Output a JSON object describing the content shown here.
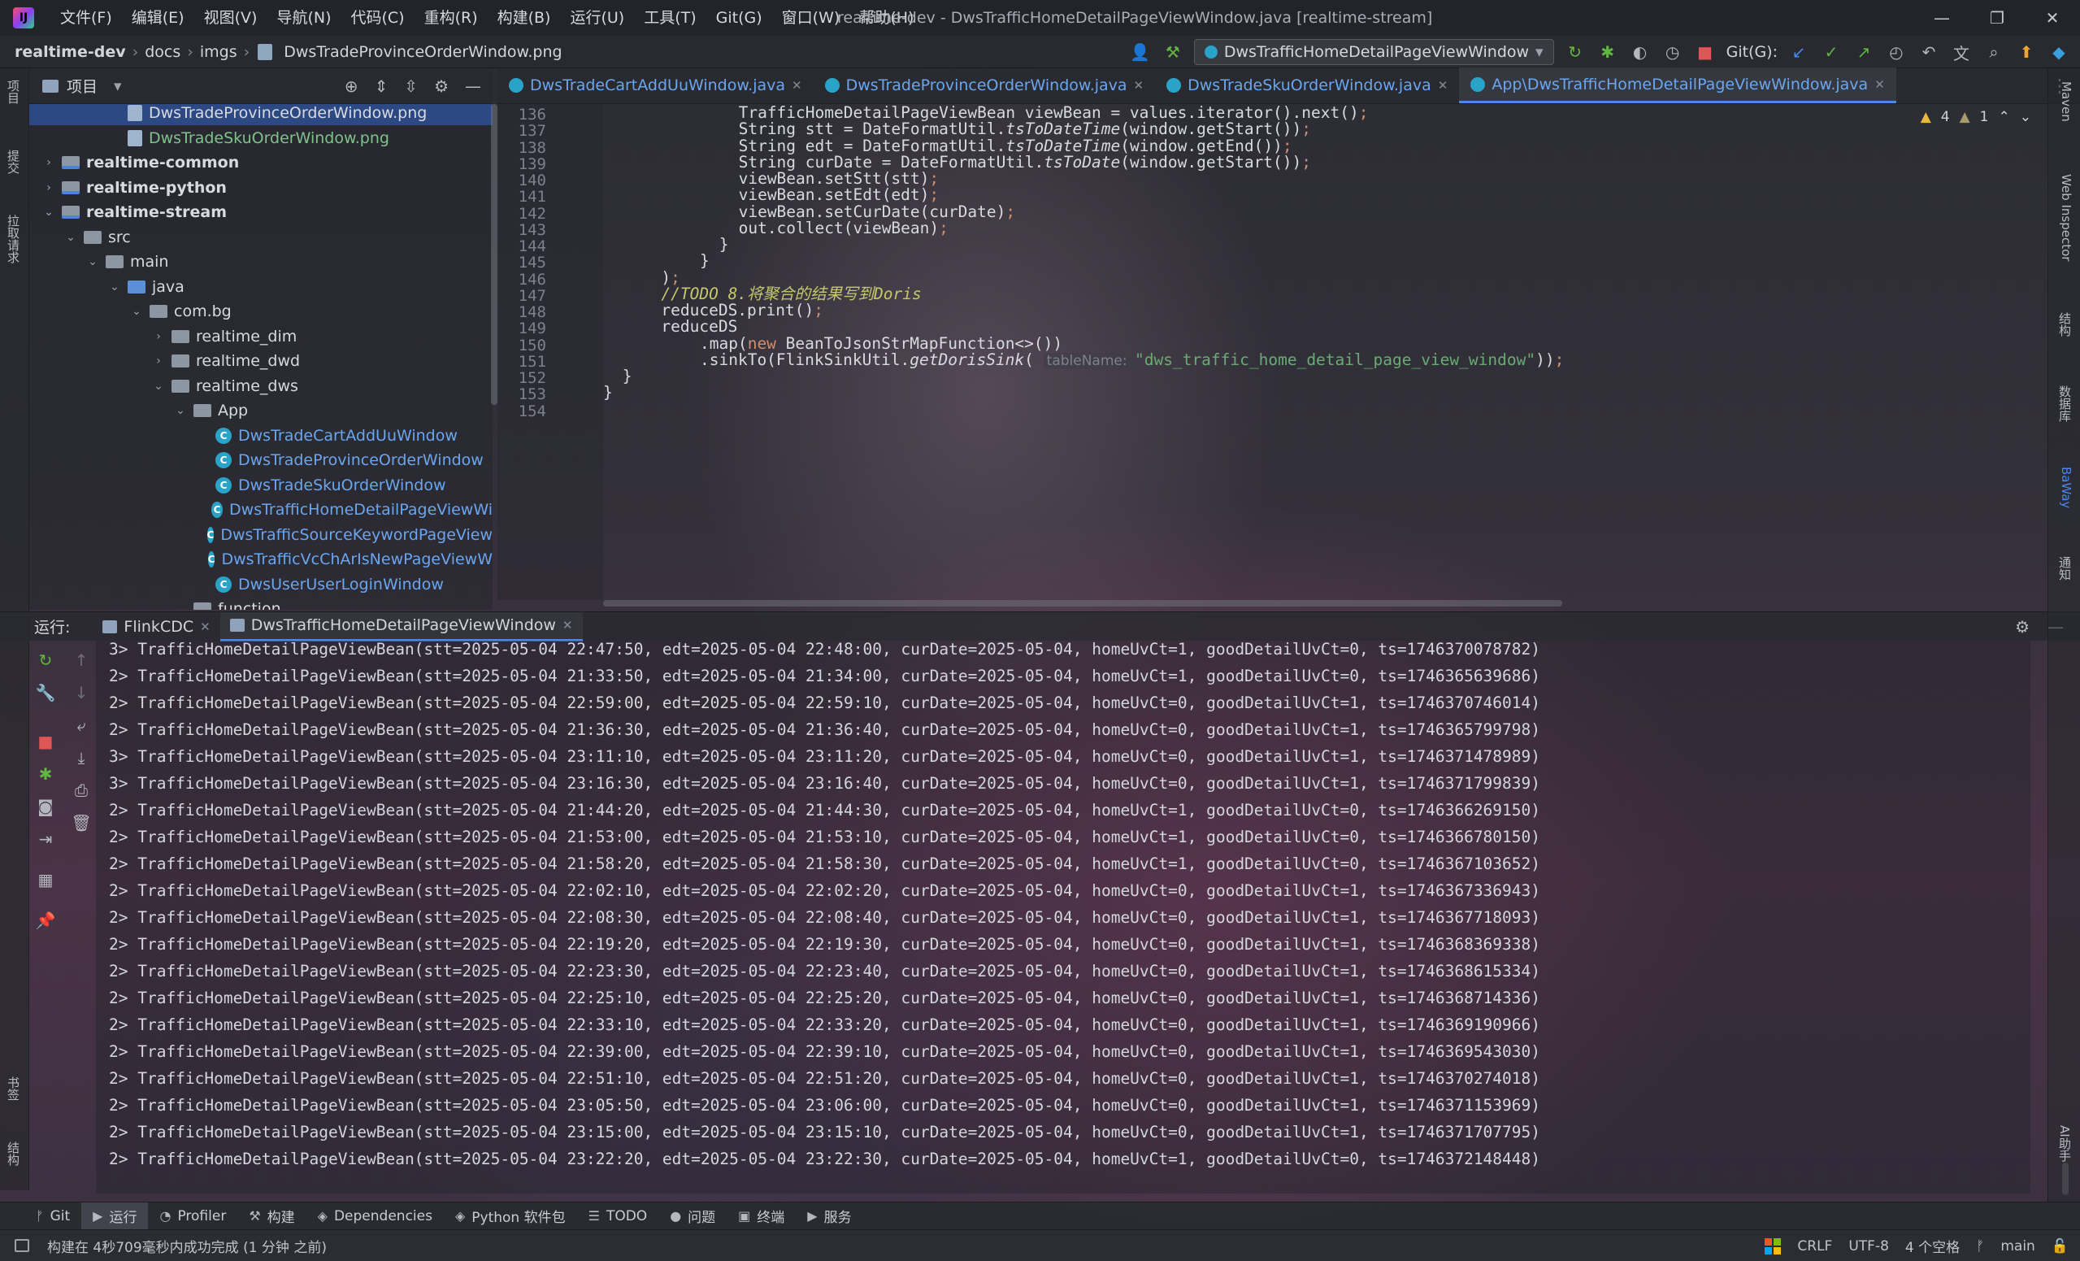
{
  "menu": [
    "文件(F)",
    "编辑(E)",
    "视图(V)",
    "导航(N)",
    "代码(C)",
    "重构(R)",
    "构建(B)",
    "运行(U)",
    "工具(T)",
    "Git(G)",
    "窗口(W)",
    "帮助(H)"
  ],
  "window_title": "realtime-dev - DwsTrafficHomeDetailPageViewWindow.java [realtime-stream]",
  "breadcrumb": [
    "realtime-dev",
    "docs",
    "imgs",
    "DwsTradeProvinceOrderWindow.png"
  ],
  "run_config": "DwsTrafficHomeDetailPageViewWindow",
  "git_label": "Git(G):",
  "left_strip": {
    "project": "项目",
    "commit": "提交",
    "pull_requests": "拉取请求",
    "bookmarks": "书签",
    "structure": "结构"
  },
  "project_panel": {
    "title": "项目"
  },
  "tree": [
    {
      "label": "DwsTradeProvinceOrderWindow.png",
      "depth": 4,
      "icon": "png",
      "style": "normal",
      "selected": true,
      "arrow": ""
    },
    {
      "label": "DwsTradeSkuOrderWindow.png",
      "depth": 4,
      "icon": "png",
      "style": "green",
      "selected": false,
      "arrow": ""
    },
    {
      "label": "realtime-common",
      "depth": 1,
      "icon": "module",
      "style": "bold",
      "selected": false,
      "arrow": "›"
    },
    {
      "label": "realtime-python",
      "depth": 1,
      "icon": "module",
      "style": "bold",
      "selected": false,
      "arrow": "›"
    },
    {
      "label": "realtime-stream",
      "depth": 1,
      "icon": "module",
      "style": "bold",
      "selected": false,
      "arrow": "⌄"
    },
    {
      "label": "src",
      "depth": 2,
      "icon": "folder",
      "style": "normal",
      "selected": false,
      "arrow": "⌄"
    },
    {
      "label": "main",
      "depth": 3,
      "icon": "folder",
      "style": "normal",
      "selected": false,
      "arrow": "⌄"
    },
    {
      "label": "java",
      "depth": 4,
      "icon": "folder-blue",
      "style": "normal",
      "selected": false,
      "arrow": "⌄"
    },
    {
      "label": "com.bg",
      "depth": 5,
      "icon": "folder",
      "style": "normal",
      "selected": false,
      "arrow": "⌄"
    },
    {
      "label": "realtime_dim",
      "depth": 6,
      "icon": "folder",
      "style": "normal",
      "selected": false,
      "arrow": "›"
    },
    {
      "label": "realtime_dwd",
      "depth": 6,
      "icon": "folder",
      "style": "normal",
      "selected": false,
      "arrow": "›"
    },
    {
      "label": "realtime_dws",
      "depth": 6,
      "icon": "folder",
      "style": "normal",
      "selected": false,
      "arrow": "⌄"
    },
    {
      "label": "App",
      "depth": 7,
      "icon": "folder",
      "style": "normal",
      "selected": false,
      "arrow": "⌄"
    },
    {
      "label": "DwsTradeCartAddUuWindow",
      "depth": 8,
      "icon": "class",
      "style": "class",
      "selected": false,
      "arrow": ""
    },
    {
      "label": "DwsTradeProvinceOrderWindow",
      "depth": 8,
      "icon": "class",
      "style": "class",
      "selected": false,
      "arrow": ""
    },
    {
      "label": "DwsTradeSkuOrderWindow",
      "depth": 8,
      "icon": "class",
      "style": "class",
      "selected": false,
      "arrow": ""
    },
    {
      "label": "DwsTrafficHomeDetailPageViewWi",
      "depth": 8,
      "icon": "class",
      "style": "class",
      "selected": false,
      "arrow": ""
    },
    {
      "label": "DwsTrafficSourceKeywordPageView",
      "depth": 8,
      "icon": "class",
      "style": "class",
      "selected": false,
      "arrow": ""
    },
    {
      "label": "DwsTrafficVcChArIsNewPageViewW",
      "depth": 8,
      "icon": "class",
      "style": "class",
      "selected": false,
      "arrow": ""
    },
    {
      "label": "DwsUserUserLoginWindow",
      "depth": 8,
      "icon": "class",
      "style": "class",
      "selected": false,
      "arrow": ""
    },
    {
      "label": "function",
      "depth": 7,
      "icon": "folder",
      "style": "normal",
      "selected": false,
      "arrow": "⌄"
    }
  ],
  "editor_tabs": [
    {
      "label": "DwsTradeCartAddUuWindow.java",
      "active": false
    },
    {
      "label": "DwsTradeProvinceOrderWindow.java",
      "active": false
    },
    {
      "label": "DwsTradeSkuOrderWindow.java",
      "active": false
    },
    {
      "label": "App\\DwsTrafficHomeDetailPageViewWindow.java",
      "active": true
    }
  ],
  "inspections": {
    "warnings": "4",
    "weak_warnings": "1"
  },
  "code_lines": [
    {
      "no": "136",
      "indent": 14,
      "segs": [
        [
          "TrafficHomeDetailPageViewBean viewBean = values.iterator().next()",
          ""
        ],
        [
          ";",
          "semi"
        ]
      ]
    },
    {
      "no": "137",
      "indent": 14,
      "segs": [
        [
          "String stt = DateFormatUtil.",
          ""
        ],
        [
          "tsToDateTime",
          "fn-italic"
        ],
        [
          "(window.getStart())",
          ""
        ],
        [
          ";",
          "semi"
        ]
      ]
    },
    {
      "no": "138",
      "indent": 14,
      "segs": [
        [
          "String edt = DateFormatUtil.",
          ""
        ],
        [
          "tsToDateTime",
          "fn-italic"
        ],
        [
          "(window.getEnd())",
          ""
        ],
        [
          ";",
          "semi"
        ]
      ]
    },
    {
      "no": "139",
      "indent": 14,
      "segs": [
        [
          "String curDate = DateFormatUtil.",
          ""
        ],
        [
          "tsToDate",
          "fn-italic"
        ],
        [
          "(window.getStart())",
          ""
        ],
        [
          ";",
          "semi"
        ]
      ]
    },
    {
      "no": "140",
      "indent": 14,
      "segs": [
        [
          "viewBean.setStt(stt)",
          ""
        ],
        [
          ";",
          "semi"
        ]
      ]
    },
    {
      "no": "141",
      "indent": 14,
      "segs": [
        [
          "viewBean.setEdt(edt)",
          ""
        ],
        [
          ";",
          "semi"
        ]
      ]
    },
    {
      "no": "142",
      "indent": 14,
      "segs": [
        [
          "viewBean.setCurDate(curDate)",
          ""
        ],
        [
          ";",
          "semi"
        ]
      ]
    },
    {
      "no": "143",
      "indent": 14,
      "segs": [
        [
          "out.collect(viewBean)",
          ""
        ],
        [
          ";",
          "semi"
        ]
      ]
    },
    {
      "no": "144",
      "indent": 12,
      "segs": [
        [
          "}",
          ""
        ]
      ]
    },
    {
      "no": "145",
      "indent": 10,
      "segs": [
        [
          "}",
          ""
        ]
      ]
    },
    {
      "no": "146",
      "indent": 6,
      "segs": [
        [
          ")",
          ""
        ],
        [
          ";",
          "semi"
        ]
      ]
    },
    {
      "no": "147",
      "indent": 6,
      "segs": [
        [
          "//TODO 8.将聚合的结果写到Doris",
          "cmt"
        ]
      ]
    },
    {
      "no": "148",
      "indent": 6,
      "segs": [
        [
          "reduceDS.print()",
          ""
        ],
        [
          ";",
          "semi"
        ]
      ]
    },
    {
      "no": "149",
      "indent": 6,
      "segs": [
        [
          "reduceDS",
          ""
        ]
      ]
    },
    {
      "no": "150",
      "indent": 10,
      "segs": [
        [
          ".map(",
          ""
        ],
        [
          "new ",
          "kw"
        ],
        [
          "BeanToJsonStrMapFunction<>())",
          ""
        ]
      ]
    },
    {
      "no": "151",
      "indent": 10,
      "segs": [
        [
          ".sinkTo(FlinkSinkUtil.",
          ""
        ],
        [
          "getDorisSink",
          "fn-italic"
        ],
        [
          "( ",
          ""
        ],
        [
          "tableName: ",
          "hint"
        ],
        [
          "\"dws_traffic_home_detail_page_view_window\"",
          "str"
        ],
        [
          "))",
          ""
        ],
        [
          ";",
          "semi"
        ]
      ]
    },
    {
      "no": "152",
      "indent": 2,
      "segs": [
        [
          "}",
          ""
        ]
      ]
    },
    {
      "no": "153",
      "indent": 0,
      "segs": [
        [
          "}",
          ""
        ]
      ]
    },
    {
      "no": "154",
      "indent": 0,
      "segs": [
        [
          "",
          ""
        ]
      ]
    }
  ],
  "run_panel": {
    "label": "运行:",
    "tabs": [
      {
        "label": "FlinkCDC",
        "active": false
      },
      {
        "label": "DwsTrafficHomeDetailPageViewWindow",
        "active": true
      }
    ]
  },
  "console_lines": [
    "3> TrafficHomeDetailPageViewBean(stt=2025-05-04 22:47:50, edt=2025-05-04 22:48:00, curDate=2025-05-04, homeUvCt=1, goodDetailUvCt=0, ts=1746370078782)",
    "2> TrafficHomeDetailPageViewBean(stt=2025-05-04 21:33:50, edt=2025-05-04 21:34:00, curDate=2025-05-04, homeUvCt=1, goodDetailUvCt=0, ts=1746365639686)",
    "2> TrafficHomeDetailPageViewBean(stt=2025-05-04 22:59:00, edt=2025-05-04 22:59:10, curDate=2025-05-04, homeUvCt=0, goodDetailUvCt=1, ts=1746370746014)",
    "2> TrafficHomeDetailPageViewBean(stt=2025-05-04 21:36:30, edt=2025-05-04 21:36:40, curDate=2025-05-04, homeUvCt=0, goodDetailUvCt=1, ts=1746365799798)",
    "3> TrafficHomeDetailPageViewBean(stt=2025-05-04 23:11:10, edt=2025-05-04 23:11:20, curDate=2025-05-04, homeUvCt=0, goodDetailUvCt=1, ts=1746371478989)",
    "3> TrafficHomeDetailPageViewBean(stt=2025-05-04 23:16:30, edt=2025-05-04 23:16:40, curDate=2025-05-04, homeUvCt=0, goodDetailUvCt=1, ts=1746371799839)",
    "2> TrafficHomeDetailPageViewBean(stt=2025-05-04 21:44:20, edt=2025-05-04 21:44:30, curDate=2025-05-04, homeUvCt=1, goodDetailUvCt=0, ts=1746366269150)",
    "2> TrafficHomeDetailPageViewBean(stt=2025-05-04 21:53:00, edt=2025-05-04 21:53:10, curDate=2025-05-04, homeUvCt=1, goodDetailUvCt=0, ts=1746366780150)",
    "2> TrafficHomeDetailPageViewBean(stt=2025-05-04 21:58:20, edt=2025-05-04 21:58:30, curDate=2025-05-04, homeUvCt=1, goodDetailUvCt=0, ts=1746367103652)",
    "2> TrafficHomeDetailPageViewBean(stt=2025-05-04 22:02:10, edt=2025-05-04 22:02:20, curDate=2025-05-04, homeUvCt=0, goodDetailUvCt=1, ts=1746367336943)",
    "2> TrafficHomeDetailPageViewBean(stt=2025-05-04 22:08:30, edt=2025-05-04 22:08:40, curDate=2025-05-04, homeUvCt=0, goodDetailUvCt=1, ts=1746367718093)",
    "2> TrafficHomeDetailPageViewBean(stt=2025-05-04 22:19:20, edt=2025-05-04 22:19:30, curDate=2025-05-04, homeUvCt=0, goodDetailUvCt=1, ts=1746368369338)",
    "2> TrafficHomeDetailPageViewBean(stt=2025-05-04 22:23:30, edt=2025-05-04 22:23:40, curDate=2025-05-04, homeUvCt=0, goodDetailUvCt=1, ts=1746368615334)",
    "2> TrafficHomeDetailPageViewBean(stt=2025-05-04 22:25:10, edt=2025-05-04 22:25:20, curDate=2025-05-04, homeUvCt=0, goodDetailUvCt=1, ts=1746368714336)",
    "2> TrafficHomeDetailPageViewBean(stt=2025-05-04 22:33:10, edt=2025-05-04 22:33:20, curDate=2025-05-04, homeUvCt=0, goodDetailUvCt=1, ts=1746369190966)",
    "2> TrafficHomeDetailPageViewBean(stt=2025-05-04 22:39:00, edt=2025-05-04 22:39:10, curDate=2025-05-04, homeUvCt=0, goodDetailUvCt=1, ts=1746369543030)",
    "2> TrafficHomeDetailPageViewBean(stt=2025-05-04 22:51:10, edt=2025-05-04 22:51:20, curDate=2025-05-04, homeUvCt=0, goodDetailUvCt=1, ts=1746370274018)",
    "2> TrafficHomeDetailPageViewBean(stt=2025-05-04 23:05:50, edt=2025-05-04 23:06:00, curDate=2025-05-04, homeUvCt=0, goodDetailUvCt=1, ts=1746371153969)",
    "2> TrafficHomeDetailPageViewBean(stt=2025-05-04 23:15:00, edt=2025-05-04 23:15:10, curDate=2025-05-04, homeUvCt=0, goodDetailUvCt=1, ts=1746371707795)",
    "2> TrafficHomeDetailPageViewBean(stt=2025-05-04 23:22:20, edt=2025-05-04 23:22:30, curDate=2025-05-04, homeUvCt=1, goodDetailUvCt=0, ts=1746372148448)"
  ],
  "bottom_tools": [
    {
      "label": "Git",
      "icon": "git-branch-icon",
      "glyph": "ᚠ",
      "active": false
    },
    {
      "label": "运行",
      "icon": "run-icon",
      "glyph": "▶",
      "active": true
    },
    {
      "label": "Profiler",
      "icon": "profiler-icon",
      "glyph": "◔",
      "active": false
    },
    {
      "label": "构建",
      "icon": "hammer-icon",
      "glyph": "⚒",
      "active": false
    },
    {
      "label": "Dependencies",
      "icon": "dependencies-icon",
      "glyph": "◈",
      "active": false
    },
    {
      "label": "Python 软件包",
      "icon": "python-packages-icon",
      "glyph": "◈",
      "active": false
    },
    {
      "label": "TODO",
      "icon": "todo-icon",
      "glyph": "☰",
      "active": false
    },
    {
      "label": "问题",
      "icon": "problems-icon",
      "glyph": "●",
      "active": false
    },
    {
      "label": "终端",
      "icon": "terminal-icon",
      "glyph": "▣",
      "active": false
    },
    {
      "label": "服务",
      "icon": "services-icon",
      "glyph": "▶",
      "active": false
    }
  ],
  "status": {
    "message": "构建在 4秒709毫秒内成功完成 (1 分钟 之前)",
    "line_sep": "CRLF",
    "encoding": "UTF-8",
    "indent": "4 个空格",
    "branch": "main"
  },
  "right_strip": {
    "maven": "Maven",
    "web_inspector": "Web Inspector",
    "structure_db": "结构",
    "database": "数据库",
    "baiway": "BaWay",
    "notifications": "通知",
    "ai": "AI助手"
  },
  "colors": {
    "accent": "#4a88ec",
    "class_name": "#6aa6ef",
    "string": "#6aab73",
    "keyword": "#cf8e6d",
    "comment": "#c5c86a"
  }
}
